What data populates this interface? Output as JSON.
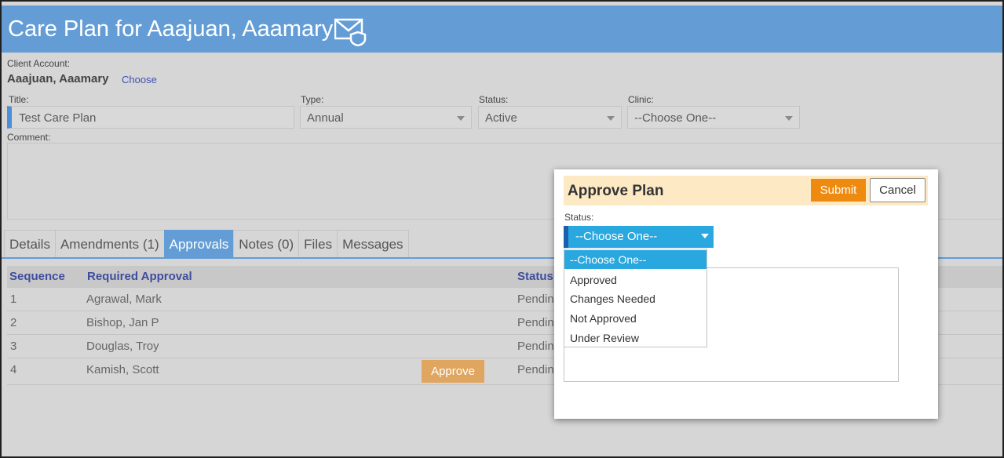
{
  "header": {
    "title": "Care Plan for Aaajuan, Aaamary",
    "icon": "mail-shield-icon"
  },
  "client": {
    "label": "Client Account:",
    "name": "Aaajuan, Aaamary",
    "choose_link": "Choose"
  },
  "form": {
    "title": {
      "label": "Title:",
      "value": "Test Care Plan"
    },
    "type": {
      "label": "Type:",
      "value": "Annual"
    },
    "status": {
      "label": "Status:",
      "value": "Active"
    },
    "clinic": {
      "label": "Clinic:",
      "value": "--Choose One--"
    },
    "comment": {
      "label": "Comment:",
      "value": ""
    }
  },
  "tabs": [
    {
      "label": "Details"
    },
    {
      "label": "Amendments (1)"
    },
    {
      "label": "Approvals",
      "active": true
    },
    {
      "label": "Notes (0)"
    },
    {
      "label": "Files"
    },
    {
      "label": "Messages"
    }
  ],
  "table": {
    "columns": {
      "sequence": "Sequence",
      "required_approval": "Required Approval",
      "status": "Status"
    },
    "rows": [
      {
        "sequence": "1",
        "name": "Agrawal, Mark",
        "status": "Pendin"
      },
      {
        "sequence": "2",
        "name": "Bishop, Jan P",
        "status": "Pendin"
      },
      {
        "sequence": "3",
        "name": "Douglas, Troy",
        "status": "Pendin"
      },
      {
        "sequence": "4",
        "name": "Kamish, Scott",
        "status": "Pendin",
        "action": "Approve"
      }
    ]
  },
  "modal": {
    "title": "Approve Plan",
    "submit_label": "Submit",
    "cancel_label": "Cancel",
    "status_label": "Status:",
    "selected": "--Choose One--",
    "options": [
      "--Choose One--",
      "Approved",
      "Changes Needed",
      "Not Approved",
      "Under Review"
    ]
  },
  "colors": {
    "header": "#649dd5",
    "accent": "#29a8e0",
    "submit": "#ef8a11",
    "approve": "#e0a660",
    "modal_header": "#fdeac4"
  }
}
